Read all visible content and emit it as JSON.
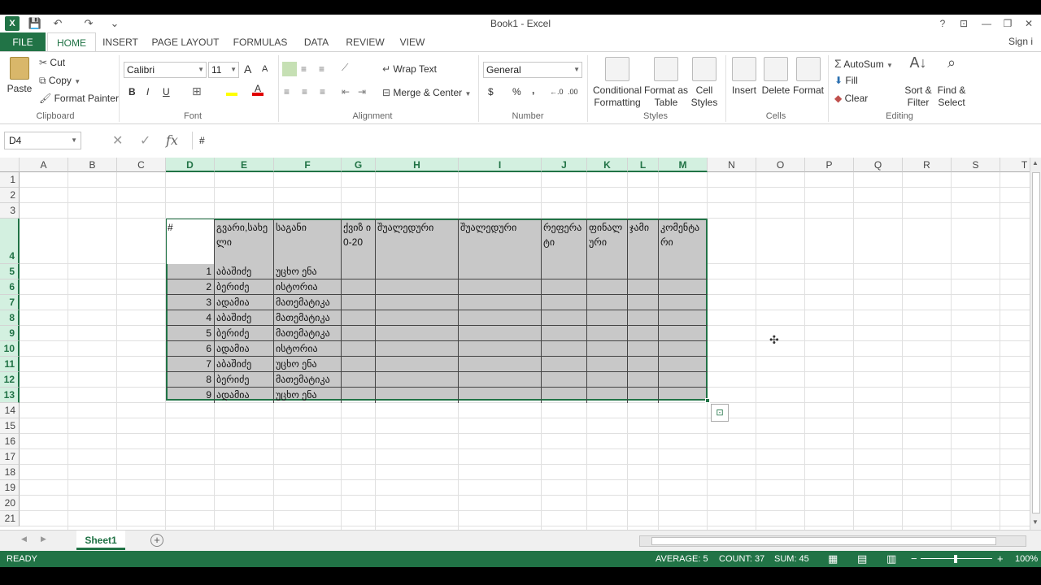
{
  "window": {
    "title": "Book1 - Excel",
    "help": "?",
    "restore_ribbon": "⊡",
    "minimize": "—",
    "maximize": "❐",
    "close": "✕",
    "sign_in": "Sign i"
  },
  "qat": {
    "app_logo": "X",
    "save": "💾",
    "undo": "↶",
    "redo": "↷",
    "customize": "⌄"
  },
  "tabs": [
    "FILE",
    "HOME",
    "INSERT",
    "PAGE LAYOUT",
    "FORMULAS",
    "DATA",
    "REVIEW",
    "VIEW"
  ],
  "ribbon": {
    "clipboard": {
      "paste": "Paste",
      "cut": "Cut",
      "copy": "Copy",
      "format_painter": "Format Painter",
      "label": "Clipboard"
    },
    "font": {
      "family": "Calibri",
      "size": "11",
      "grow": "A",
      "shrink": "A",
      "bold": "B",
      "italic": "I",
      "underline": "U",
      "label": "Font"
    },
    "alignment": {
      "wrap_text": "Wrap Text",
      "merge_center": "Merge & Center",
      "label": "Alignment"
    },
    "number": {
      "format": "General",
      "currency": "$",
      "percent": "%",
      "comma": ",",
      "inc_decimal": "←.0",
      "dec_decimal": ".00",
      "label": "Number"
    },
    "styles": {
      "conditional": [
        "Conditional",
        "Formatting"
      ],
      "format_table": [
        "Format as",
        "Table"
      ],
      "cell_styles": [
        "Cell",
        "Styles"
      ],
      "label": "Styles"
    },
    "cells": {
      "insert": "Insert",
      "delete": "Delete",
      "format": "Format",
      "label": "Cells"
    },
    "editing": {
      "autosum": "AutoSum",
      "fill": "Fill",
      "clear": "Clear",
      "sort_filter": [
        "Sort &",
        "Filter"
      ],
      "find_select": [
        "Find &",
        "Select"
      ],
      "label": "Editing"
    }
  },
  "formula_bar": {
    "name_box": "D4",
    "cancel": "✕",
    "enter": "✓",
    "fx": "fx",
    "content": "#"
  },
  "columns": [
    "A",
    "B",
    "C",
    "D",
    "E",
    "F",
    "G",
    "H",
    "I",
    "J",
    "K",
    "L",
    "M",
    "N",
    "O",
    "P",
    "Q",
    "R",
    "S",
    "T"
  ],
  "selected_columns": [
    "D",
    "E",
    "F",
    "G",
    "H",
    "I",
    "J",
    "K",
    "L",
    "M"
  ],
  "rows": [
    "1",
    "2",
    "3",
    "4",
    "5",
    "6",
    "7",
    "8",
    "9",
    "10",
    "11",
    "12",
    "13",
    "14",
    "15",
    "16",
    "17",
    "18",
    "19",
    "20",
    "21"
  ],
  "selected_rows": [
    "4",
    "5",
    "6",
    "7",
    "8",
    "9",
    "10",
    "11",
    "12",
    "13"
  ],
  "table": {
    "headers": [
      "#",
      "გვარი,სახე ლი",
      "საგანი",
      "ქვიზ ი 0-20",
      "შუალედური",
      "შუალედური",
      "რეფერა ტი",
      "ფინალ ური",
      "ჯამი",
      "კომენტა რი"
    ],
    "rows": [
      [
        "1",
        "აბაშიძე",
        "უცხო ენა"
      ],
      [
        "2",
        "ბერიძე",
        "ისტორია"
      ],
      [
        "3",
        "ადამია",
        "მათემატიკა"
      ],
      [
        "4",
        "აბაშიძე",
        "მათემატიკა"
      ],
      [
        "5",
        "ბერიძე",
        "მათემატიკა"
      ],
      [
        "6",
        "ადამია",
        "ისტორია"
      ],
      [
        "7",
        "აბაშიძე",
        "უცხო ენა"
      ],
      [
        "8",
        "ბერიძე",
        "მათემატიკა"
      ],
      [
        "9",
        "ადამია",
        "უცხო ენა"
      ]
    ]
  },
  "sheets": {
    "active": "Sheet1",
    "add": "+"
  },
  "status": {
    "mode": "READY",
    "average": "AVERAGE: 5",
    "count": "COUNT: 37",
    "sum": "SUM: 45",
    "zoom": "100%",
    "zoom_minus": "−",
    "zoom_plus": "+"
  },
  "colors": {
    "accent": "#217346",
    "selection_fill": "#c8c8c8"
  }
}
